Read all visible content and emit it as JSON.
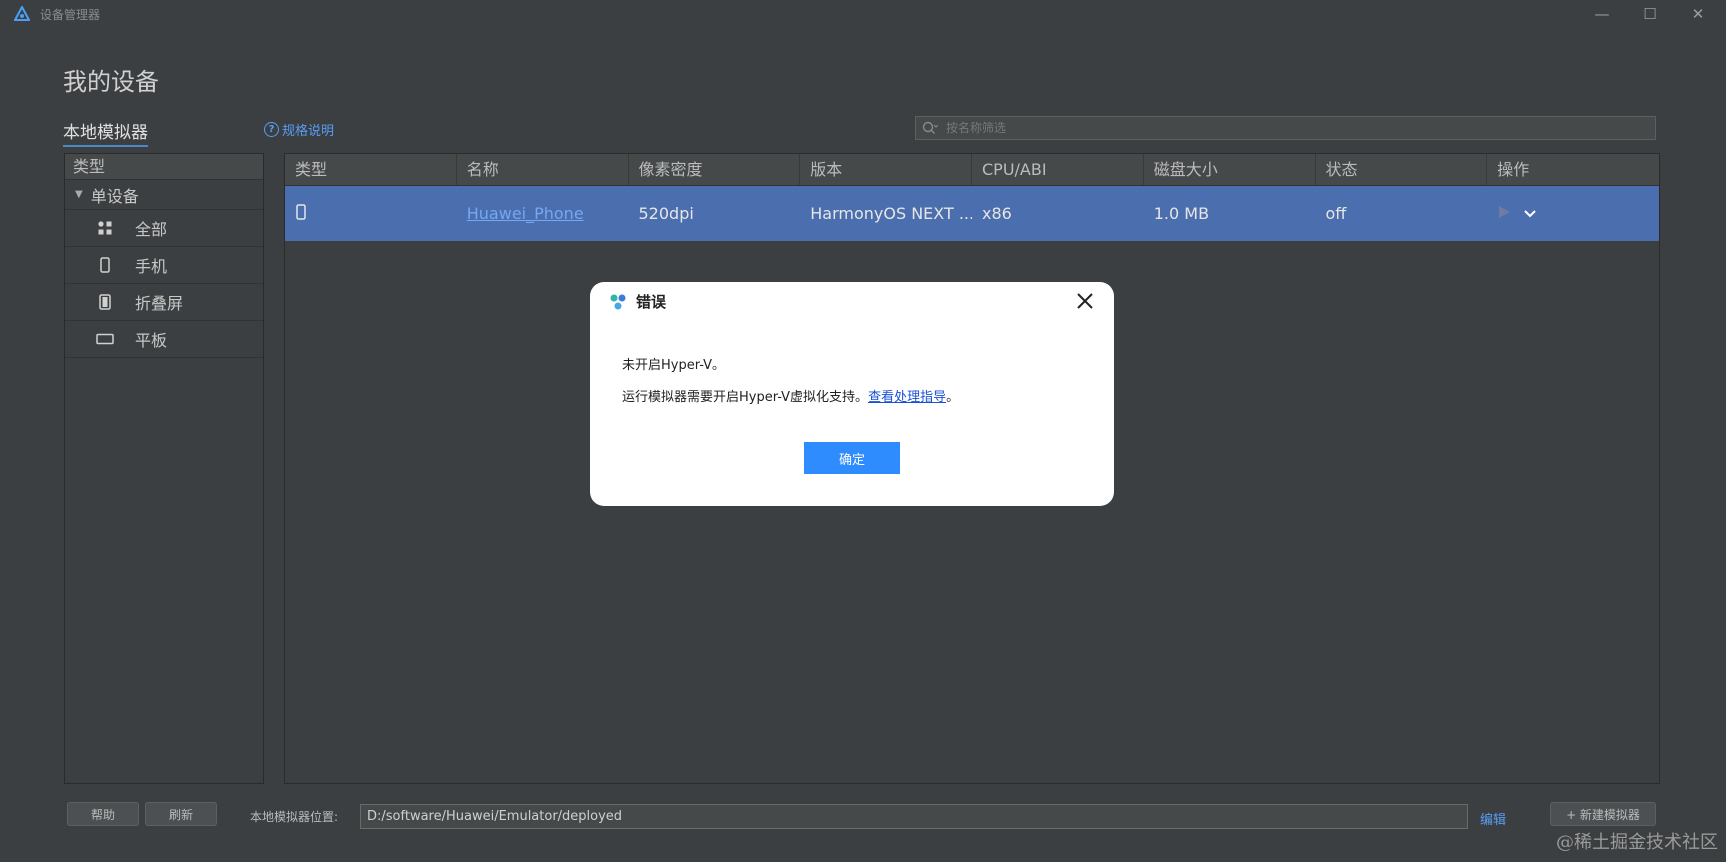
{
  "window": {
    "title": "设备管理器"
  },
  "page": {
    "heading": "我的设备"
  },
  "tabs": {
    "local": "本地模拟器"
  },
  "spec_link": "规格说明",
  "search": {
    "placeholder": "按名称筛选"
  },
  "sidebar": {
    "header": "类型",
    "group": "单设备",
    "items": [
      {
        "label": "全部",
        "icon": "grid-icon"
      },
      {
        "label": "手机",
        "icon": "phone-icon"
      },
      {
        "label": "折叠屏",
        "icon": "foldable-icon"
      },
      {
        "label": "平板",
        "icon": "tablet-icon"
      }
    ]
  },
  "table": {
    "headers": [
      "类型",
      "名称",
      "像素密度",
      "版本",
      "CPU/ABI",
      "磁盘大小",
      "状态",
      "操作"
    ],
    "rows": [
      {
        "name": "Huawei_Phone",
        "density": "520dpi",
        "version": "HarmonyOS NEXT ...",
        "cpu": "x86",
        "disk": "1.0 MB",
        "status": "off"
      }
    ]
  },
  "footer": {
    "help": "帮助",
    "refresh": "刷新",
    "location_label": "本地模拟器位置:",
    "location_value": "D:/software/Huawei/Emulator/deployed",
    "edit": "编辑",
    "new_emulator": "+ 新建模拟器"
  },
  "dialog": {
    "title": "错误",
    "line1": "未开启Hyper-V。",
    "line2_text": "运行模拟器需要开启Hyper-V虚拟化支持。",
    "line2_link": "查看处理指导",
    "line2_end": "。",
    "ok": "确定"
  },
  "watermark": "@稀土掘金技术社区",
  "colors": {
    "selected_row": "#4b6eaf",
    "link": "#589df6",
    "primary_button": "#2f8cff"
  }
}
